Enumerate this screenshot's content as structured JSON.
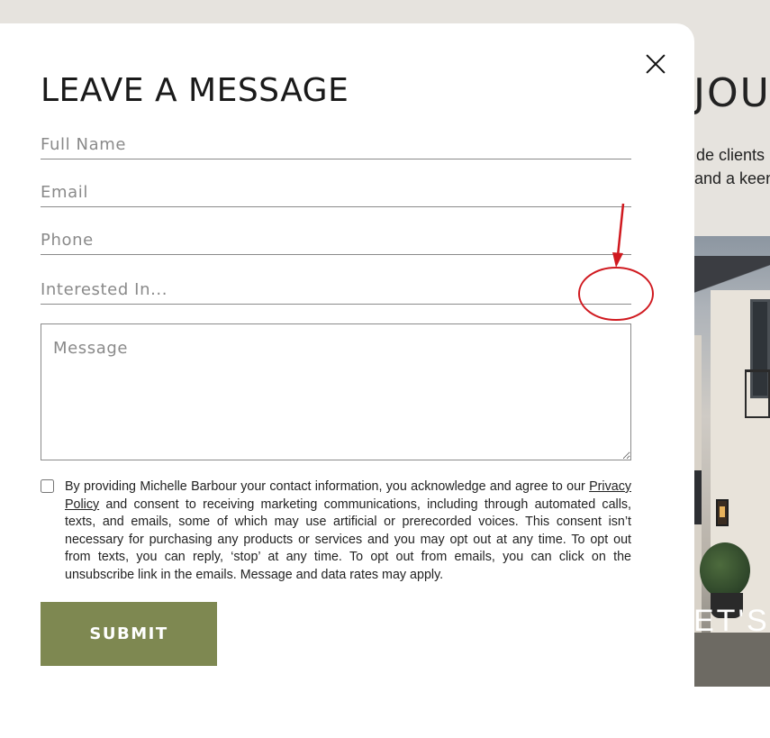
{
  "background": {
    "heading_fragment": "JOU",
    "line1_fragment": "de clients",
    "line2_fragment": "and a keen",
    "lets_fragment": "ET'S"
  },
  "modal": {
    "title": "LEAVE A MESSAGE",
    "close_icon": "close-icon",
    "fields": {
      "full_name_placeholder": "Full Name",
      "email_placeholder": "Email",
      "phone_placeholder": "Phone",
      "interested_placeholder": "Interested In...",
      "message_placeholder": "Message"
    },
    "consent": {
      "before_link": "By providing Michelle Barbour your contact information, you acknowledge and agree to our ",
      "link_text": "Privacy Policy",
      "after_link": " and consent to receiving marketing communications, including through automated calls, texts, and emails, some of which may use artificial or prerecorded voices. This consent isn’t necessary for purchasing any products or services and you may opt out at any time. To opt out from texts, you can reply, ‘stop’ at any time. To opt out from emails, you can click on the unsubscribe link in the emails. Message and data rates may apply."
    },
    "submit_label": "SUBMIT"
  },
  "annotation": {
    "color": "#d0191f"
  }
}
